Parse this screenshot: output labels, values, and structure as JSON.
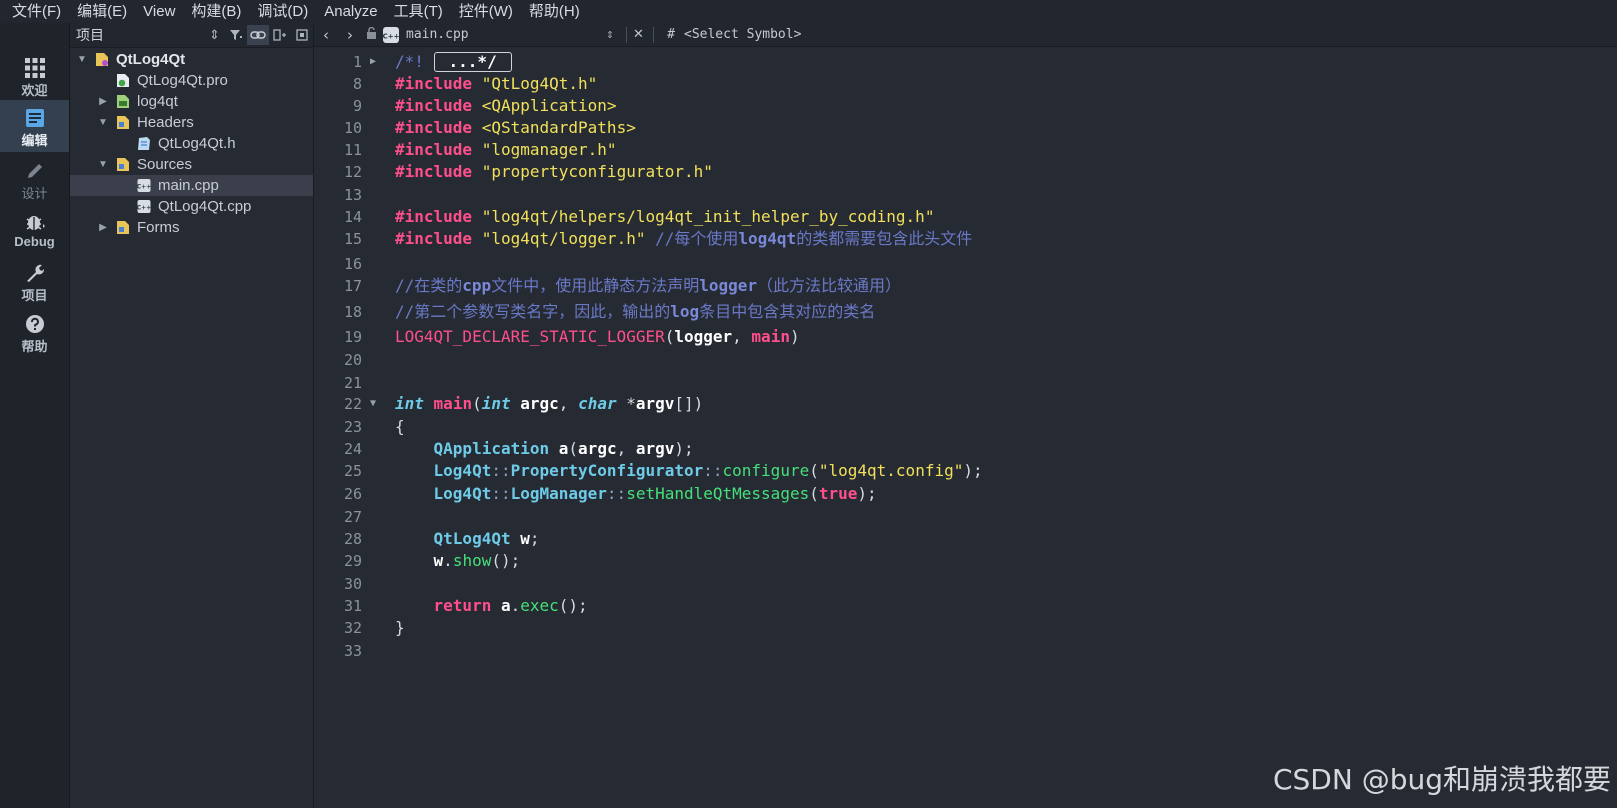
{
  "menu": [
    "文件(F)",
    "编辑(E)",
    "View",
    "构建(B)",
    "调试(D)",
    "Analyze",
    "工具(T)",
    "控件(W)",
    "帮助(H)"
  ],
  "modes": [
    {
      "label": "欢迎",
      "icon": "grid-icon"
    },
    {
      "label": "编辑",
      "icon": "document-icon"
    },
    {
      "label": "设计",
      "icon": "pencil-icon"
    },
    {
      "label": "Debug",
      "icon": "bug-icon"
    },
    {
      "label": "项目",
      "icon": "wrench-icon"
    },
    {
      "label": "帮助",
      "icon": "help-icon"
    }
  ],
  "project_panel": {
    "title": "项目",
    "tree": [
      {
        "label": "QtLog4Qt",
        "level": 0,
        "arrow": "▼",
        "icon": "project-icon"
      },
      {
        "label": "QtLog4Qt.pro",
        "level": 1,
        "arrow": "",
        "icon": "pro-file-icon"
      },
      {
        "label": "log4qt",
        "level": 1,
        "arrow": "▶",
        "icon": "subproject-icon"
      },
      {
        "label": "Headers",
        "level": 1,
        "arrow": "▼",
        "icon": "folder-icon"
      },
      {
        "label": "QtLog4Qt.h",
        "level": 2,
        "arrow": "",
        "icon": "header-file-icon"
      },
      {
        "label": "Sources",
        "level": 1,
        "arrow": "▼",
        "icon": "folder-icon"
      },
      {
        "label": "main.cpp",
        "level": 2,
        "arrow": "",
        "icon": "cpp-file-icon",
        "selected": true
      },
      {
        "label": "QtLog4Qt.cpp",
        "level": 2,
        "arrow": "",
        "icon": "cpp-file-icon"
      },
      {
        "label": "Forms",
        "level": 1,
        "arrow": "▶",
        "icon": "folder-icon"
      }
    ]
  },
  "editor_toolbar": {
    "file_name": "main.cpp",
    "hash": "#",
    "symbol": "<Select Symbol>"
  },
  "code_lines": [
    {
      "n": "1",
      "fold": "▶",
      "tokens": [
        [
          "cmt",
          "/*! "
        ],
        [
          "box",
          "...*/"
        ]
      ]
    },
    {
      "n": "8",
      "tokens": [
        [
          "pp",
          "#include"
        ],
        [
          "pl",
          " "
        ],
        [
          "str",
          "\"QtLog4Qt.h\""
        ]
      ]
    },
    {
      "n": "9",
      "tokens": [
        [
          "pp",
          "#include"
        ],
        [
          "pl",
          " "
        ],
        [
          "str",
          "<QApplication>"
        ]
      ]
    },
    {
      "n": "10",
      "tokens": [
        [
          "pp",
          "#include"
        ],
        [
          "pl",
          " "
        ],
        [
          "str",
          "<QStandardPaths>"
        ]
      ]
    },
    {
      "n": "11",
      "tokens": [
        [
          "pp",
          "#include"
        ],
        [
          "pl",
          " "
        ],
        [
          "str",
          "\"logmanager.h\""
        ]
      ]
    },
    {
      "n": "12",
      "tokens": [
        [
          "pp",
          "#include"
        ],
        [
          "pl",
          " "
        ],
        [
          "str",
          "\"propertyconfigurator.h\""
        ]
      ]
    },
    {
      "n": "13",
      "tokens": []
    },
    {
      "n": "14",
      "tokens": [
        [
          "pp",
          "#include"
        ],
        [
          "pl",
          " "
        ],
        [
          "str",
          "\"log4qt/helpers/log4qt_init_helper_by_coding.h\""
        ]
      ]
    },
    {
      "n": "15",
      "tokens": [
        [
          "pp",
          "#include"
        ],
        [
          "pl",
          " "
        ],
        [
          "str",
          "\"log4qt/logger.h\""
        ],
        [
          "pl",
          " "
        ],
        [
          "cmt",
          "//每个使用"
        ],
        [
          "cmtb",
          "log4qt"
        ],
        [
          "cmt",
          "的类都需要包含此头文件"
        ]
      ]
    },
    {
      "n": "16",
      "tokens": []
    },
    {
      "n": "17",
      "tokens": [
        [
          "cmt",
          "//在类的"
        ],
        [
          "cmtb",
          "cpp"
        ],
        [
          "cmt",
          "文件中，使用此静态方法声明"
        ],
        [
          "cmtb",
          "logger"
        ],
        [
          "cmt",
          "（此方法比较通用）"
        ]
      ]
    },
    {
      "n": "18",
      "tokens": [
        [
          "cmt",
          "//第二个参数写类名字，因此，输出的"
        ],
        [
          "cmtb",
          "log"
        ],
        [
          "cmt",
          "条目中包含其对应的类名"
        ]
      ]
    },
    {
      "n": "19",
      "tokens": [
        [
          "mac",
          "LOG4QT_DECLARE_STATIC_LOGGER"
        ],
        [
          "pl",
          "("
        ],
        [
          "id",
          "logger"
        ],
        [
          "pl",
          ", "
        ],
        [
          "mainf",
          "main"
        ],
        [
          "pl",
          ")"
        ]
      ]
    },
    {
      "n": "20",
      "tokens": []
    },
    {
      "n": "21",
      "tokens": []
    },
    {
      "n": "22",
      "fold": "▼",
      "tokens": [
        [
          "kw",
          "int"
        ],
        [
          "pl",
          " "
        ],
        [
          "mainf",
          "main"
        ],
        [
          "pl",
          "("
        ],
        [
          "kw",
          "int"
        ],
        [
          "pl",
          " "
        ],
        [
          "id",
          "argc"
        ],
        [
          "pl",
          ", "
        ],
        [
          "kw",
          "char"
        ],
        [
          "pl",
          " *"
        ],
        [
          "id",
          "argv"
        ],
        [
          "pl",
          "[])"
        ]
      ]
    },
    {
      "n": "23",
      "tokens": [
        [
          "pl",
          "{"
        ]
      ]
    },
    {
      "n": "24",
      "tokens": [
        [
          "pl",
          "    "
        ],
        [
          "typ",
          "QApplication"
        ],
        [
          "pl",
          " "
        ],
        [
          "id",
          "a"
        ],
        [
          "pl",
          "("
        ],
        [
          "id",
          "argc"
        ],
        [
          "pl",
          ", "
        ],
        [
          "id",
          "argv"
        ],
        [
          "pl",
          ");"
        ]
      ]
    },
    {
      "n": "25",
      "tokens": [
        [
          "pl",
          "    "
        ],
        [
          "typ",
          "Log4Qt"
        ],
        [
          "op",
          "::"
        ],
        [
          "typ",
          "PropertyConfigurator"
        ],
        [
          "op",
          "::"
        ],
        [
          "fn",
          "configure"
        ],
        [
          "pl",
          "("
        ],
        [
          "str",
          "\"log4qt.config\""
        ],
        [
          "pl",
          ");"
        ]
      ]
    },
    {
      "n": "26",
      "tokens": [
        [
          "pl",
          "    "
        ],
        [
          "typ",
          "Log4Qt"
        ],
        [
          "op",
          "::"
        ],
        [
          "typ",
          "LogManager"
        ],
        [
          "op",
          "::"
        ],
        [
          "fn",
          "setHandleQtMessages"
        ],
        [
          "pl",
          "("
        ],
        [
          "bool",
          "true"
        ],
        [
          "pl",
          ");"
        ]
      ]
    },
    {
      "n": "27",
      "tokens": []
    },
    {
      "n": "28",
      "tokens": [
        [
          "pl",
          "    "
        ],
        [
          "typ",
          "QtLog4Qt"
        ],
        [
          "pl",
          " "
        ],
        [
          "id",
          "w"
        ],
        [
          "pl",
          ";"
        ]
      ]
    },
    {
      "n": "29",
      "tokens": [
        [
          "pl",
          "    "
        ],
        [
          "id",
          "w"
        ],
        [
          "pl",
          "."
        ],
        [
          "fn",
          "show"
        ],
        [
          "pl",
          "();"
        ]
      ]
    },
    {
      "n": "30",
      "tokens": []
    },
    {
      "n": "31",
      "tokens": [
        [
          "pl",
          "    "
        ],
        [
          "ret",
          "return"
        ],
        [
          "pl",
          " "
        ],
        [
          "id",
          "a"
        ],
        [
          "pl",
          "."
        ],
        [
          "fn",
          "exec"
        ],
        [
          "pl",
          "();"
        ]
      ]
    },
    {
      "n": "32",
      "tokens": [
        [
          "pl",
          "}"
        ]
      ]
    },
    {
      "n": "33",
      "tokens": []
    }
  ],
  "watermark": "CSDN @bug和崩溃我都要"
}
